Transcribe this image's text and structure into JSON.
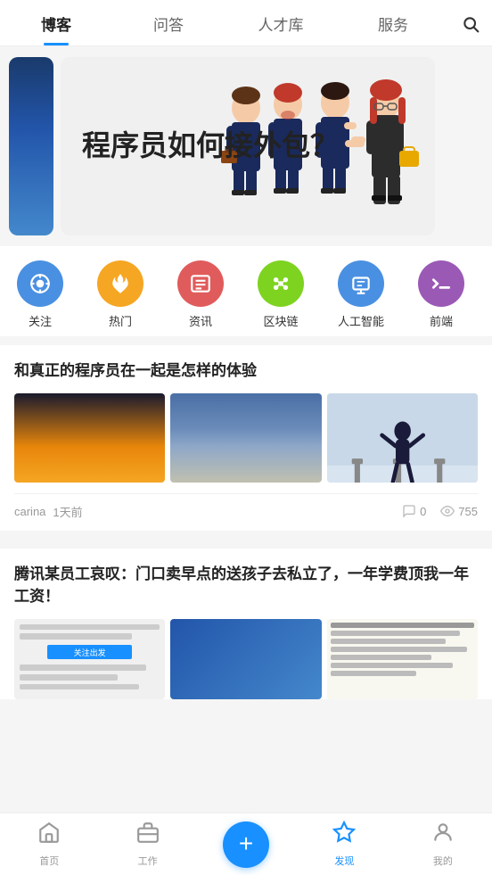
{
  "nav": {
    "tabs": [
      {
        "label": "博客",
        "active": true
      },
      {
        "label": "问答",
        "active": false
      },
      {
        "label": "人才库",
        "active": false
      },
      {
        "label": "服务",
        "active": false
      }
    ]
  },
  "banner": {
    "title": "程序员如何接外包？"
  },
  "categories": [
    {
      "label": "关注",
      "icon": "🎯",
      "color": "#4a90e2"
    },
    {
      "label": "热门",
      "icon": "🔥",
      "color": "#f5a623"
    },
    {
      "label": "资讯",
      "icon": "📄",
      "color": "#e05c5c"
    },
    {
      "label": "区块链",
      "icon": "🔗",
      "color": "#7ed321"
    },
    {
      "label": "人工智能",
      "icon": "💻",
      "color": "#4a90e2"
    },
    {
      "label": "前端",
      "icon": "⚡",
      "color": "#9b59b6"
    }
  ],
  "article1": {
    "title": "和真正的程序员在一起是怎样的体验",
    "author": "carina",
    "time": "1天前",
    "comments": "0",
    "views": "755"
  },
  "article2": {
    "title": "腾讯某员工哀叹：门口卖早点的送孩子去私立了，一年学费顶我一年工资！"
  },
  "bottomNav": {
    "items": [
      {
        "label": "首页",
        "active": false
      },
      {
        "label": "工作",
        "active": false
      },
      {
        "label": "发布",
        "active": false,
        "isPublish": true
      },
      {
        "label": "发现",
        "active": true
      },
      {
        "label": "我的",
        "active": false
      }
    ]
  }
}
